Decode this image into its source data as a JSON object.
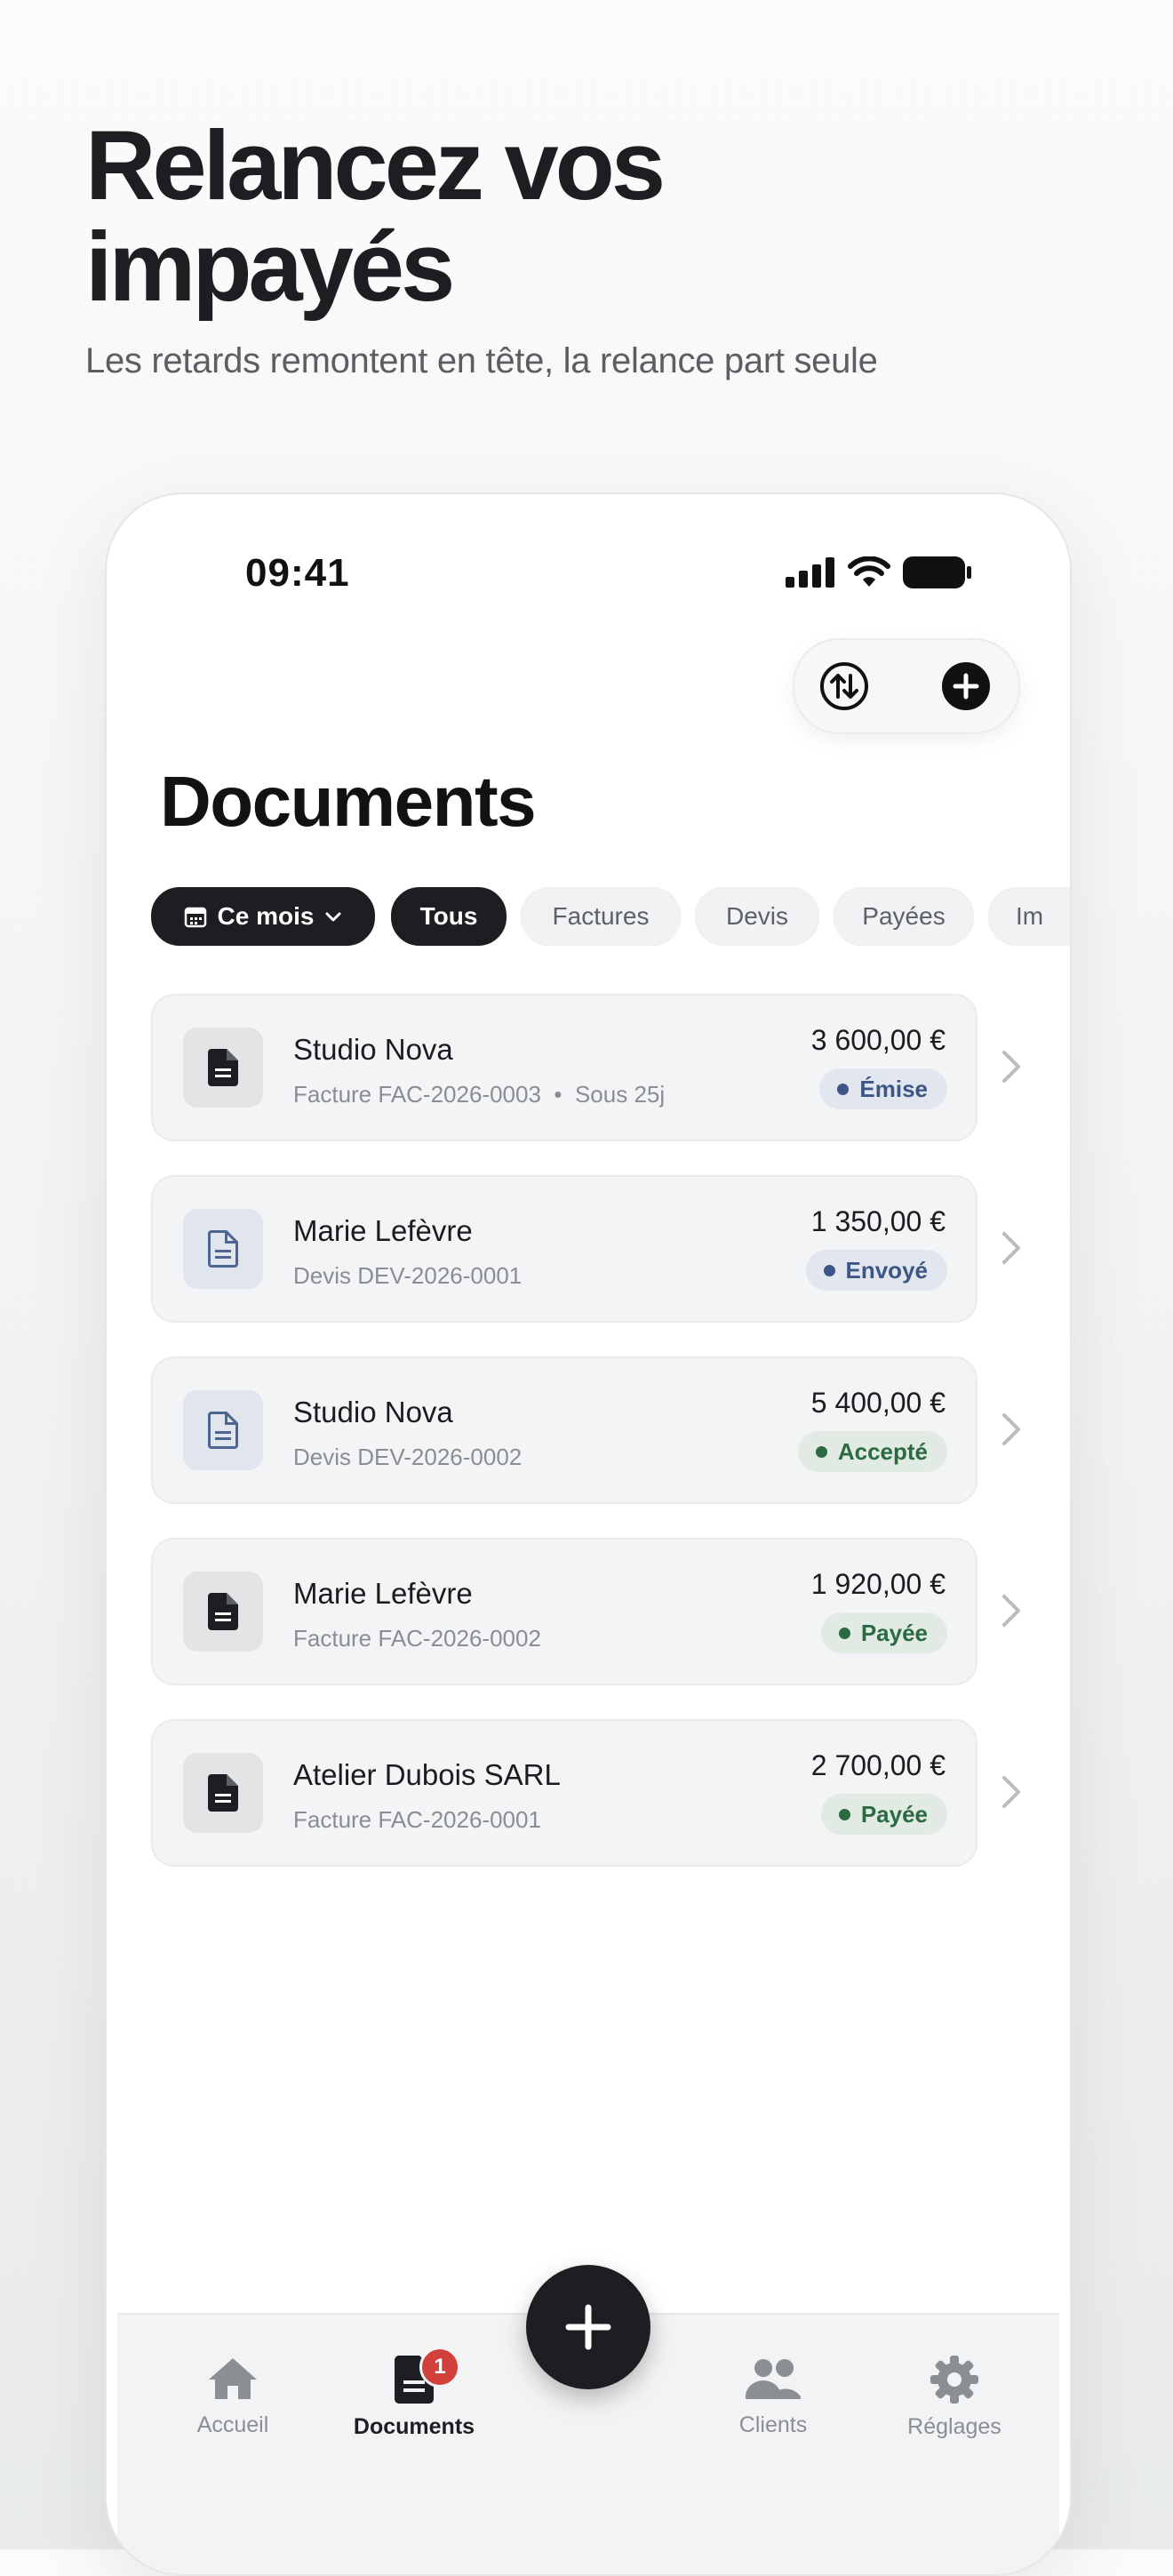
{
  "hero": {
    "title": "Relancez vos impayés",
    "subtitle": "Les retards remontent en tête, la relance part seule"
  },
  "status_bar": {
    "time": "09:41",
    "icons": [
      "cellular-signal-icon",
      "wifi-icon",
      "battery-icon"
    ]
  },
  "toolbar": {
    "icons": [
      "sort-icon",
      "add-circle-icon"
    ]
  },
  "page": {
    "title": "Documents"
  },
  "filters": {
    "period": {
      "label": "Ce mois",
      "icon": "calendar-icon",
      "dropdown_icon": "chevron-down-icon"
    },
    "chips": [
      {
        "label": "Tous",
        "selected": true
      },
      {
        "label": "Factures",
        "selected": false
      },
      {
        "label": "Devis",
        "selected": false
      },
      {
        "label": "Payées",
        "selected": false
      },
      {
        "label": "Im",
        "selected": false
      }
    ]
  },
  "documents": [
    {
      "client": "Studio Nova",
      "type_ref": "Facture FAC-2026-0003",
      "due": "Sous 25j",
      "amount": "3 600,00 €",
      "status": "Émise",
      "status_color": "#3d5687",
      "icon": "invoice-icon"
    },
    {
      "client": "Marie Lefèvre",
      "type_ref": "Devis DEV-2026-0001",
      "due": "",
      "amount": "1 350,00 €",
      "status": "Envoyé",
      "status_color": "#3d5687",
      "icon": "quote-icon"
    },
    {
      "client": "Studio Nova",
      "type_ref": "Devis DEV-2026-0002",
      "due": "",
      "amount": "5 400,00 €",
      "status": "Accepté",
      "status_color": "#2c6b42",
      "icon": "quote-icon"
    },
    {
      "client": "Marie Lefèvre",
      "type_ref": "Facture FAC-2026-0002",
      "due": "",
      "amount": "1 920,00 €",
      "status": "Payée",
      "status_color": "#2c6b42",
      "icon": "invoice-icon"
    },
    {
      "client": "Atelier Dubois SARL",
      "type_ref": "Facture FAC-2026-0001",
      "due": "",
      "amount": "2 700,00 €",
      "status": "Payée",
      "status_color": "#2c6b42",
      "icon": "invoice-icon"
    }
  ],
  "tabbar": {
    "tabs": [
      {
        "label": "Accueil",
        "icon": "home-icon",
        "active": false
      },
      {
        "label": "Documents",
        "icon": "document-icon",
        "active": true,
        "badge": "1"
      },
      {
        "label": "Clients",
        "icon": "users-icon",
        "active": false
      },
      {
        "label": "Réglages",
        "icon": "gear-icon",
        "active": false
      }
    ],
    "fab_icon": "plus-icon"
  },
  "colors": {
    "dark": "#1c1e22",
    "badge_red": "#d1403a",
    "blue_status": "#3d5687",
    "green_status": "#2c6b42"
  }
}
